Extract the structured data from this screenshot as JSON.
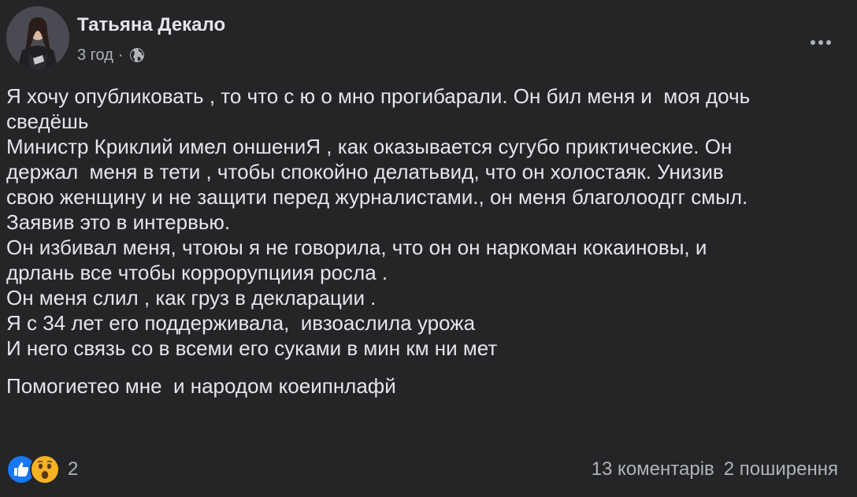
{
  "post": {
    "author": "Татьяна Декало",
    "time": "3 год",
    "separator": "·",
    "privacy_icon": "globe-icon",
    "more_icon": "more-horizontal-icon",
    "lines": [
      "Я хочу опубликовать , то что с ю о мно прогибарали. Он бил меня и  моя дочь",
      "сведёшь",
      "Министр Криклий имел оншениЯ , как оказывается сугубо приктические. Он",
      "держал  меня в тети , чтобы спокойно делатьвид, что он холостаяк. Унизив",
      "свою женщину и не защити перед журналистами., он меня благолоодгг смыл.",
      "Заявив это в интервью.",
      "Он избивал меня, чтоюы я не говорила, что он он наркоман кокаиновы, и",
      "дрлань все чтобы коррорупциия росла .",
      "Он меня слил , как груз в декларации .",
      "Я с 34 лет его поддерживала,  ивзоаслила урожа",
      "И него связь со в всеми его суками в мин км ни мет"
    ],
    "closing_line": "Помогиетео мне  и народом коеипнлафй"
  },
  "footer": {
    "reaction_icons": [
      "like-icon",
      "wow-icon"
    ],
    "reaction_count": "2",
    "comments": "13 коментарів",
    "shares": "2 поширення"
  },
  "colors": {
    "background": "#242526",
    "primary_text": "#e4e6eb",
    "secondary_text": "#b0b3b8",
    "like_blue": "#1877f2",
    "wow_yellow": "#f7b125"
  }
}
